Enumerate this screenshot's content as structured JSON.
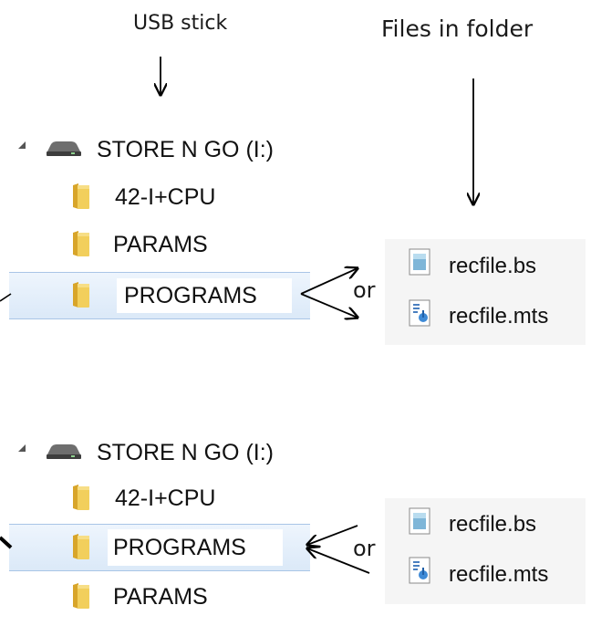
{
  "captions": {
    "usb": "USB stick",
    "files": "Files in folder"
  },
  "panel_top": {
    "drive_label": "STORE N GO (I:)",
    "folders": [
      "42-I+CPU",
      "PARAMS",
      "PROGRAMS"
    ],
    "selected_folder": "PROGRAMS"
  },
  "panel_bottom": {
    "drive_label": "STORE N GO (I:)",
    "folders": [
      "42-I+CPU",
      "PROGRAMS",
      "PARAMS"
    ],
    "selected_folder": "PROGRAMS"
  },
  "files_top": [
    "recfile.bs",
    "recfile.mts"
  ],
  "files_bottom": [
    "recfile.bs",
    "recfile.mts"
  ],
  "connector_text": "or",
  "icons": {
    "expand": "expand-triangle-icon",
    "drive": "drive-icon",
    "folder": "folder-icon",
    "bs_file": "bs-file-icon",
    "mts_file": "mts-file-icon"
  },
  "colors": {
    "selection": "#dbe9f8",
    "selection_border": "#a9c5e6",
    "folder": "#e8c04a",
    "file_panel": "#f5f5f5"
  }
}
